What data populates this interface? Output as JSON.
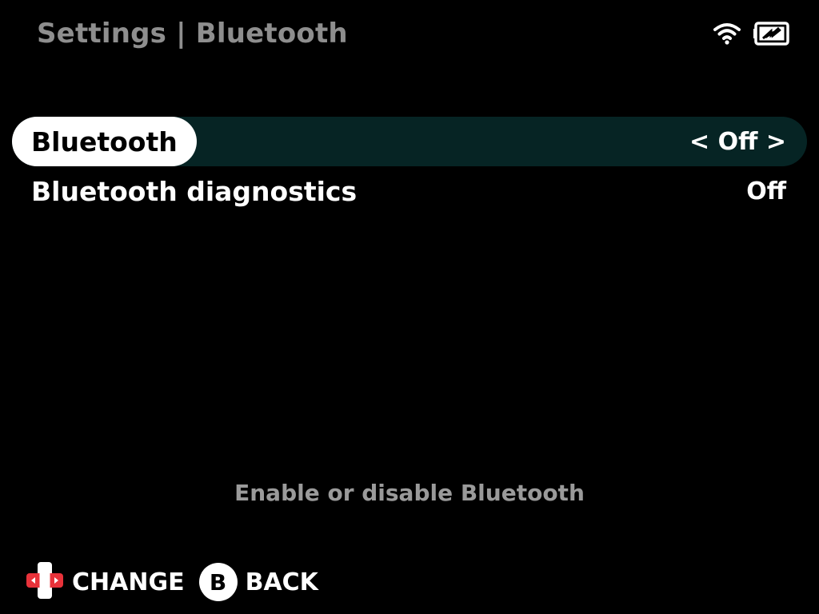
{
  "header": {
    "title": "Settings | Bluetooth"
  },
  "status_bar": {
    "icons": [
      "wifi-icon",
      "battery-charging-icon"
    ]
  },
  "menu": {
    "items": [
      {
        "label": "Bluetooth",
        "value": "< Off >",
        "selected": true
      },
      {
        "label": "Bluetooth diagnostics",
        "value": "Off",
        "selected": false
      }
    ]
  },
  "description": "Enable or disable Bluetooth",
  "footer": {
    "change_icon": "dpad-icon",
    "change_label": "CHANGE",
    "back_button": "B",
    "back_label": "BACK"
  },
  "colors": {
    "background": "#000000",
    "selected_row": "#062424",
    "header_text": "#8e8e8e",
    "dpad_accent": "#e8323a"
  }
}
